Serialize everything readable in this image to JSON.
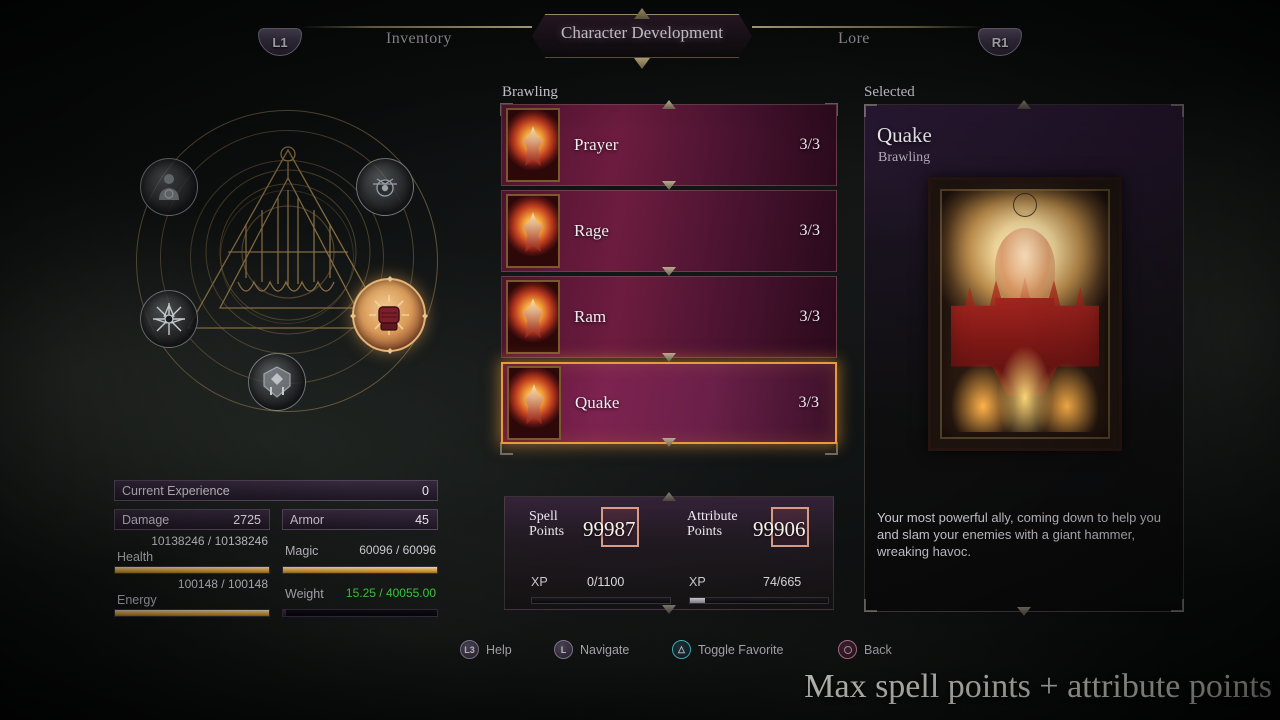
{
  "nav": {
    "left_bumper": "L1",
    "right_bumper": "R1",
    "tabs": [
      {
        "label": "Inventory",
        "active": false
      },
      {
        "label": "Character Development",
        "active": true
      },
      {
        "label": "Lore",
        "active": false
      }
    ]
  },
  "wheel": {
    "nodes": [
      {
        "icon": "body-silhouette-icon",
        "selected": false
      },
      {
        "icon": "alchemy-orb-icon",
        "selected": false
      },
      {
        "icon": "starburst-icon",
        "selected": false
      },
      {
        "icon": "shield-crest-icon",
        "selected": false
      },
      {
        "icon": "fist-brawling-icon",
        "selected": true
      }
    ]
  },
  "stats": {
    "experience": {
      "label": "Current Experience",
      "value": "0"
    },
    "damage": {
      "label": "Damage",
      "value": "2725"
    },
    "armor": {
      "label": "Armor",
      "value": "45"
    },
    "health": {
      "label": "Health",
      "value": "10138246 / 10138246",
      "percent": 100
    },
    "energy": {
      "label": "Energy",
      "value": "100148 / 100148",
      "percent": 100
    },
    "magic": {
      "label": "Magic",
      "value": "60096 / 60096",
      "percent": 100
    },
    "weight": {
      "label": "Weight",
      "value": "15.25 / 40055.00",
      "percent": 1,
      "color": "#49e04a"
    }
  },
  "skilltree": {
    "category_title": "Brawling",
    "skills": [
      {
        "name": "Prayer",
        "rank": "3/3",
        "selected": false,
        "icon": "prayer-card-icon"
      },
      {
        "name": "Rage",
        "rank": "3/3",
        "selected": false,
        "icon": "rage-card-icon"
      },
      {
        "name": "Ram",
        "rank": "3/3",
        "selected": false,
        "icon": "ram-card-icon"
      },
      {
        "name": "Quake",
        "rank": "3/3",
        "selected": true,
        "icon": "quake-card-icon"
      }
    ]
  },
  "points": {
    "spell": {
      "label_line1": "Spell",
      "label_line2": "Points",
      "value": "99987",
      "xp_label": "XP",
      "xp_value": "0/1100",
      "xp_percent": 0
    },
    "attribute": {
      "label_line1": "Attribute",
      "label_line2": "Points",
      "value": "99906",
      "xp_label": "XP",
      "xp_value": "74/665",
      "xp_percent": 11
    }
  },
  "selected": {
    "panel_title": "Selected",
    "name": "Quake",
    "category": "Brawling",
    "card_icon": "quake-card-art",
    "description": "Your most powerful ally, coming down to help you and slam your enemies with a giant hammer, wreaking havoc."
  },
  "footer": {
    "buttons": [
      {
        "glyph": "L3",
        "label": "Help",
        "icon": "l3-stick-icon"
      },
      {
        "glyph": "L",
        "label": "Navigate",
        "icon": "l-stick-icon"
      },
      {
        "glyph": "",
        "label": "Toggle Favorite",
        "icon": "triangle-button-icon"
      },
      {
        "glyph": "",
        "label": "Back",
        "icon": "circle-button-icon"
      }
    ]
  },
  "caption": "Max spell points + attribute points",
  "colors": {
    "accent_gold": "#e2b476",
    "selection_orange": "#e99a3c",
    "skill_row_magenta": "#6d1c3f",
    "weight_green": "#49e04a"
  }
}
